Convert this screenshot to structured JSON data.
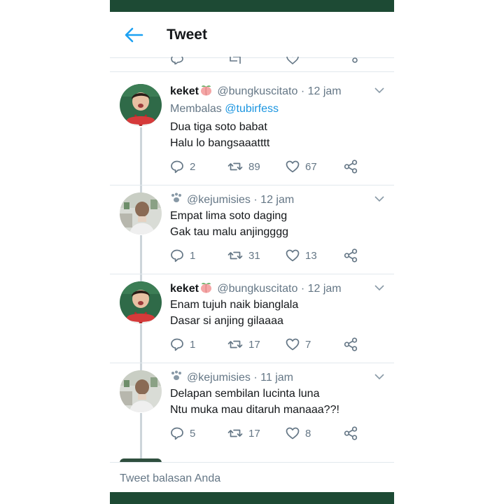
{
  "header": {
    "title": "Tweet"
  },
  "composer": {
    "placeholder": "Tweet balasan Anda"
  },
  "colors": {
    "brand_bar": "#1d4a34",
    "link": "#1b95e0",
    "muted": "#657786",
    "accent": "#1da1f2"
  },
  "tweets": [
    {
      "name": "keket",
      "handle": "@bungkuscitato",
      "time": "12 jam",
      "replying_label": "Membalas",
      "replying_to": "@tubirfess",
      "lines": [
        "Dua tiga soto babat",
        "Halu lo bangsaaatttt"
      ],
      "replies": "2",
      "retweets": "89",
      "likes": "67"
    },
    {
      "handle": "@kejumisies",
      "time": "12 jam",
      "lines": [
        "Empat lima soto daging",
        "Gak tau malu anjingggg"
      ],
      "replies": "1",
      "retweets": "31",
      "likes": "13"
    },
    {
      "name": "keket",
      "handle": "@bungkuscitato",
      "time": "12 jam",
      "lines": [
        "Enam tujuh naik bianglala",
        "Dasar si anjing gilaaaa"
      ],
      "replies": "1",
      "retweets": "17",
      "likes": "7"
    },
    {
      "handle": "@kejumisies",
      "time": "11 jam",
      "lines": [
        "Delapan sembilan lucinta luna",
        "Ntu muka mau ditaruh manaaa??!"
      ],
      "replies": "5",
      "retweets": "17",
      "likes": "8"
    }
  ],
  "icons": {
    "back": "arrow-left-icon",
    "reply": "reply-icon",
    "retweet": "retweet-icon",
    "like": "heart-icon",
    "share": "share-icon",
    "more": "chevron-down-icon",
    "peach": "peach-emoji-icon",
    "paw": "paw-print-icon"
  }
}
